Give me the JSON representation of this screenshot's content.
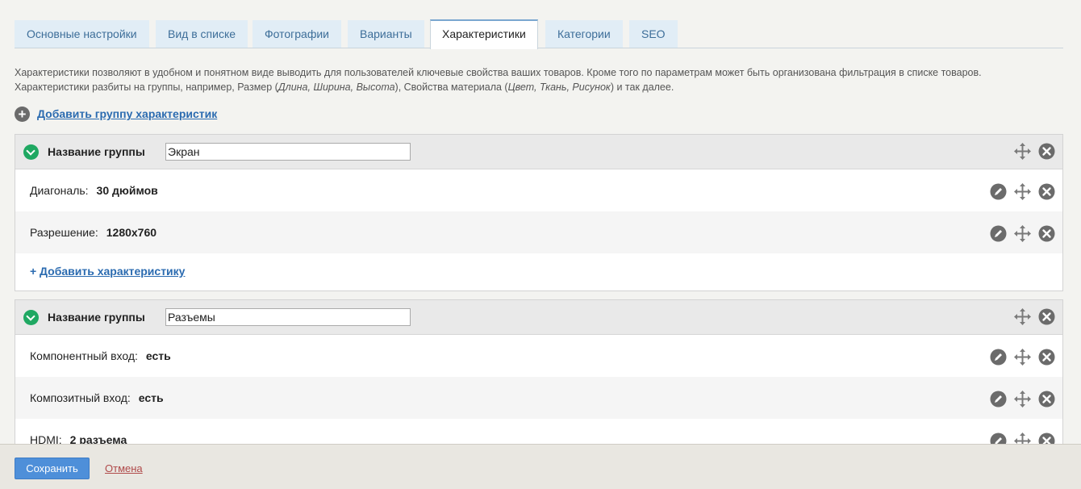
{
  "tabs": [
    {
      "label": "Основные настройки"
    },
    {
      "label": "Вид в списке"
    },
    {
      "label": "Фотографии"
    },
    {
      "label": "Варианты"
    },
    {
      "label": "Характеристики"
    },
    {
      "label": "Категории"
    },
    {
      "label": "SEO"
    }
  ],
  "active_tab": "Характеристики",
  "description": {
    "line1": "Характеристики позволяют в удобном и понятном виде выводить для пользователей ключевые свойства ваших товаров. Кроме того по параметрам может быть организована фильтрация в списке товаров.",
    "line2_a": "Характеристики разбиты на группы, например, Размер (",
    "line2_b": "Длина, Ширина, Высота",
    "line2_c": "), Свойства материала (",
    "line2_d": "Цвет, Ткань, Рисунок",
    "line2_e": ") и так далее."
  },
  "add_group_label": "Добавить группу характеристик",
  "group_name_label": "Название группы",
  "add_char_plus": "+",
  "add_char_label": "Добавить характеристику",
  "groups": [
    {
      "name": "Экран",
      "rows": [
        {
          "label": "Диагональ:",
          "value": "30 дюймов"
        },
        {
          "label": "Разрешение:",
          "value": "1280x760"
        }
      ]
    },
    {
      "name": "Разъемы",
      "rows": [
        {
          "label": "Компонентный вход:",
          "value": "есть"
        },
        {
          "label": "Композитный вход:",
          "value": "есть"
        },
        {
          "label": "HDMI:",
          "value": "2 разъема"
        }
      ]
    }
  ],
  "footer": {
    "save_label": "Сохранить",
    "cancel_label": "Отмена"
  },
  "colors": {
    "tab_bg": "#e1edf6",
    "tab_text": "#3d6e99",
    "link": "#2b6bb0",
    "chevron": "#1fa862",
    "save_button": "#4e8fd9",
    "cancel_link": "#b04a4a"
  },
  "icons": {
    "group_toggle": "chevron-down-icon",
    "move": "move-icon",
    "delete": "close-icon",
    "edit": "pencil-icon",
    "add_group": "plus-icon"
  }
}
